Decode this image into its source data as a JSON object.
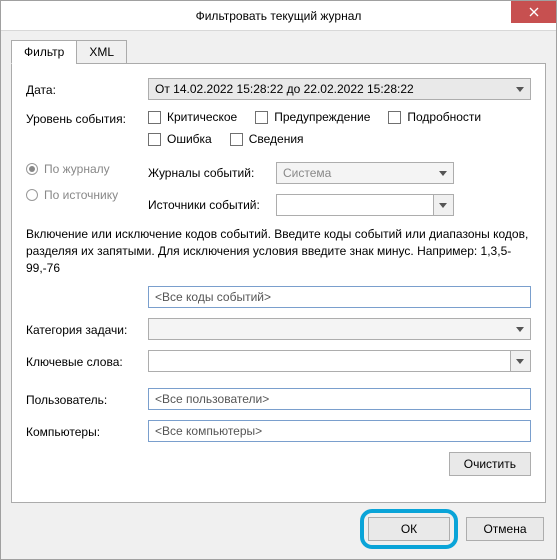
{
  "window": {
    "title": "Фильтровать текущий журнал"
  },
  "tabs": {
    "filter": "Фильтр",
    "xml": "XML"
  },
  "labels": {
    "date": "Дата:",
    "level": "Уровень события:",
    "byJournal": "По журналу",
    "bySource": "По источнику",
    "journals": "Журналы событий:",
    "sources": "Источники событий:",
    "info": "Включение или исключение кодов событий. Введите коды событий или диапазоны кодов, разделяя их запятыми. Для исключения условия введите знак минус. Например: 1,3,5-99,-76",
    "category": "Категория задачи:",
    "keywords": "Ключевые слова:",
    "user": "Пользователь:",
    "computers": "Компьютеры:"
  },
  "fields": {
    "dateRange": "От 14.02.2022 15:28:22 до 22.02.2022 15:28:22",
    "journal": "Система",
    "sources": "",
    "eventIds": "<Все коды событий>",
    "category": "",
    "keywords": "",
    "user": "<Все пользователи>",
    "computers": "<Все компьютеры>"
  },
  "levels": {
    "critical": "Критическое",
    "warning": "Предупреждение",
    "verbose": "Подробности",
    "error": "Ошибка",
    "info": "Сведения"
  },
  "buttons": {
    "clear": "Очистить",
    "ok": "ОК",
    "cancel": "Отмена"
  }
}
